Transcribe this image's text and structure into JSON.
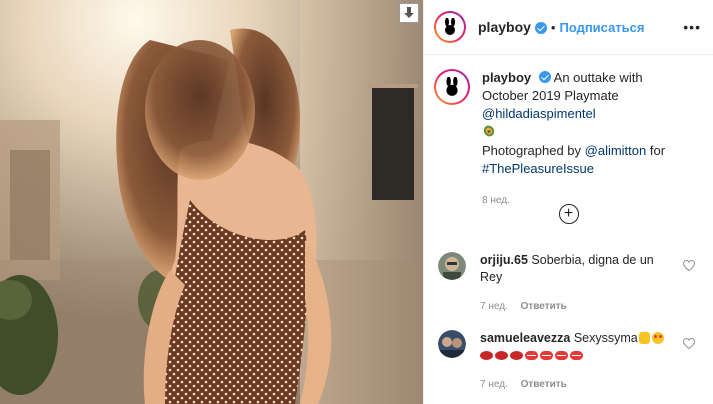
{
  "header": {
    "username": "playboy",
    "separator": "•",
    "follow_label": "Подписаться",
    "more_label": "•••"
  },
  "caption": {
    "username": "playboy",
    "text_1": "An outtake with October 2019 Playmate ",
    "mention_1": "@hildadiaspimentel",
    "text_2": "Photographed by ",
    "mention_2": "@alimitton",
    "text_3": " for ",
    "hashtag": "#ThePleasureIssue",
    "time": "8 нед."
  },
  "comments": [
    {
      "username": "orjiju.65",
      "text": "Soberbia, digna de un Rey",
      "time": "7 нед.",
      "reply_label": "Ответить"
    },
    {
      "username": "samueleavezza",
      "text": "Sexyssyma",
      "time": "7 нед.",
      "reply_label": "Ответить"
    }
  ],
  "colors": {
    "accent": "#3897f0",
    "link": "#00376b",
    "muted": "#8e8e8e"
  },
  "icons": {
    "download": "download-arrow-icon",
    "verified": "verified-badge-icon",
    "add_comment": "plus-circle-icon",
    "like": "heart-icon"
  }
}
